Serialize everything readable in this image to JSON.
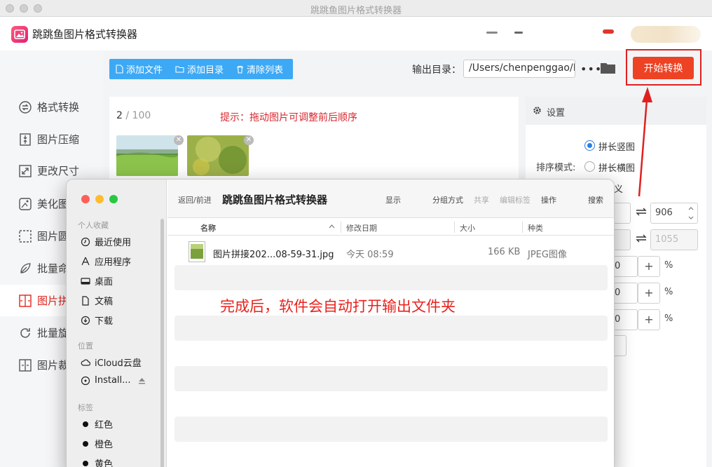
{
  "window": {
    "title": "跳跳鱼图片格式转换器"
  },
  "app": {
    "name": "跳跳鱼图片格式转换器"
  },
  "colors": {
    "accent": "#ee4224",
    "toolbar": "#3da9f5",
    "tip": "#d9272e",
    "highlight": "#e02020"
  },
  "sidebar": {
    "items": [
      {
        "label": "格式转换",
        "icon": "convert-icon"
      },
      {
        "label": "图片压缩",
        "icon": "compress-icon"
      },
      {
        "label": "更改尺寸",
        "icon": "resize-icon"
      },
      {
        "label": "美化图",
        "icon": "beautify-icon"
      },
      {
        "label": "图片圆",
        "icon": "round-corner-icon"
      },
      {
        "label": "批量命",
        "icon": "rename-icon"
      },
      {
        "label": "图片拼",
        "icon": "stitch-icon",
        "active": true
      },
      {
        "label": "批量旋",
        "icon": "rotate-icon"
      },
      {
        "label": "图片裁",
        "icon": "crop-icon"
      }
    ]
  },
  "toolbar": {
    "add_file": "添加文件",
    "add_dir": "添加目录",
    "clear_list": "清除列表",
    "output_label": "输出目录：",
    "output_path": "/Users/chenpenggao/D",
    "more": "•••",
    "start": "开始转换"
  },
  "content": {
    "count_current": "2",
    "count_total": "/ 100",
    "tip": "提示：拖动图片可调整前后顺序"
  },
  "settings": {
    "title": "设置",
    "sort_label": "排序模式:",
    "option_vertical": "拼长竖图",
    "option_horizontal": "拼长横图",
    "option_custom_partial": "义",
    "width_value": "906",
    "height_value": "1055",
    "pct_symbol": "%",
    "val_partial": "0"
  },
  "finder": {
    "title": "跳跳鱼图片格式转换器",
    "back_forward": "返回/前进",
    "toolbar": {
      "show": "显示",
      "group": "分组方式",
      "share": "共享",
      "edit_tags": "编辑标签",
      "action": "操作",
      "search": "搜索"
    },
    "sidebar": {
      "favorites_label": "个人收藏",
      "favorites": [
        "最近使用",
        "应用程序",
        "桌面",
        "文稿",
        "下载"
      ],
      "locations_label": "位置",
      "locations": [
        "iCloud云盘",
        "Install..."
      ],
      "tags_label": "标签",
      "tags": [
        "红色",
        "橙色",
        "黄色"
      ]
    },
    "columns": {
      "name": "名称",
      "modified": "修改日期",
      "size": "大小",
      "kind": "种类"
    },
    "files": [
      {
        "name": "图片拼接202...08-59-31.jpg",
        "modified": "今天 08:59",
        "size": "166 KB",
        "kind": "JPEG图像"
      }
    ]
  },
  "annotation": {
    "text": "完成后，软件会自动打开输出文件夹"
  }
}
